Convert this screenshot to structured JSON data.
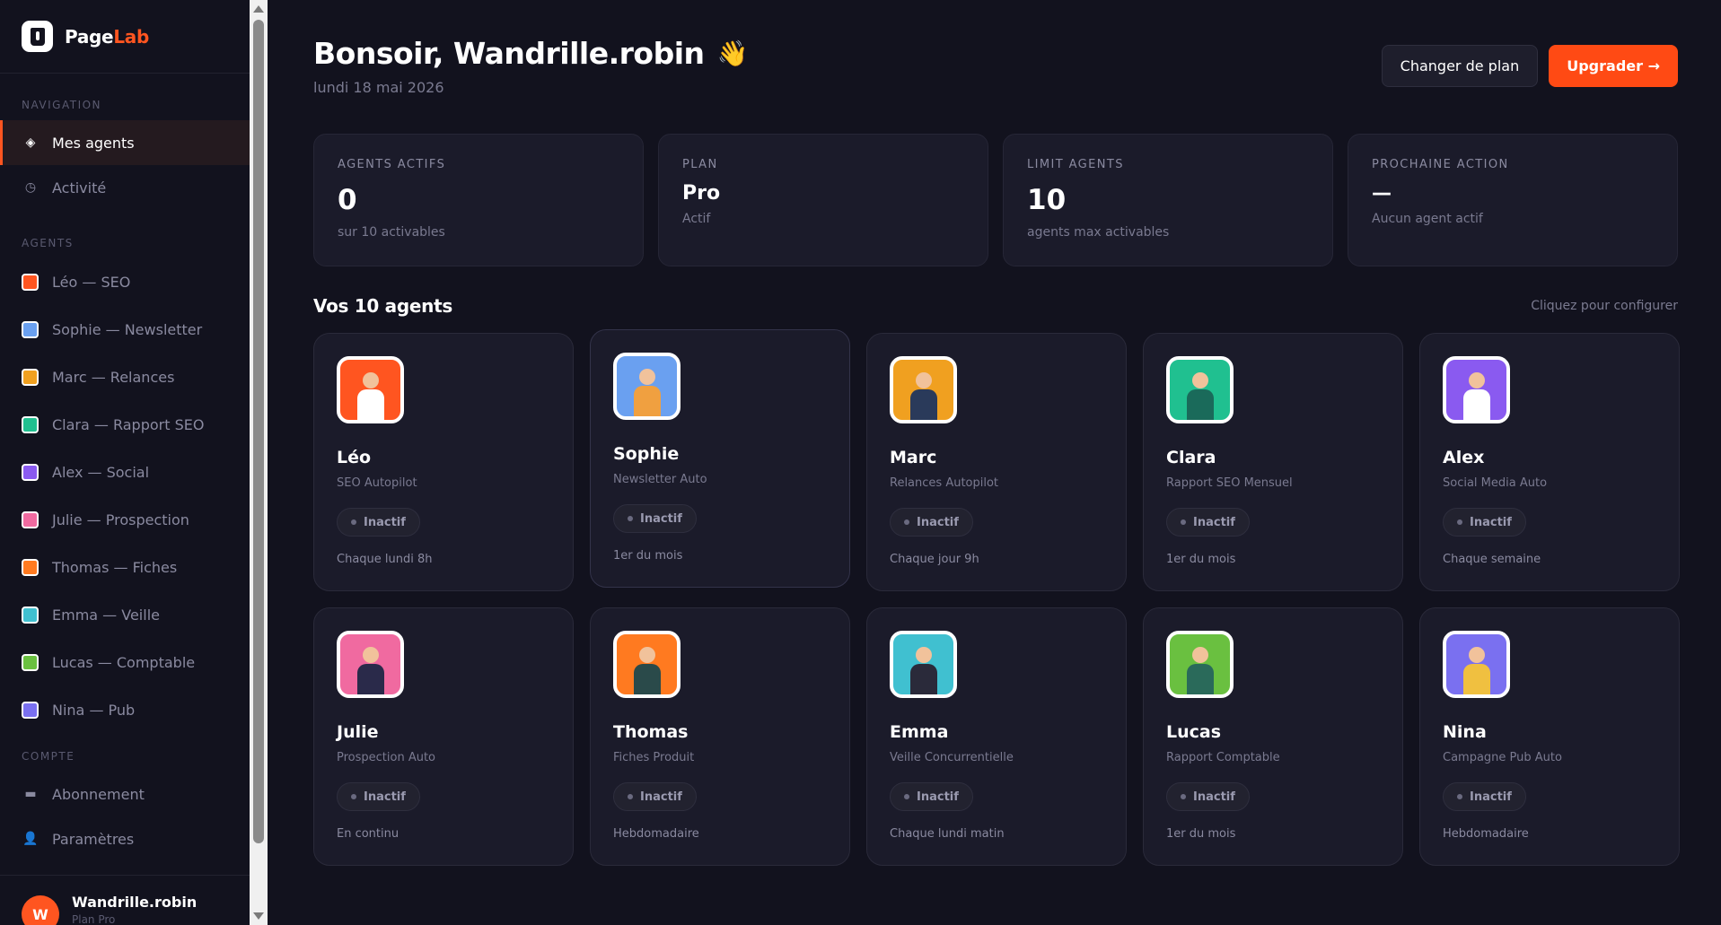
{
  "brand": {
    "name_part1": "Page",
    "name_part2": "Lab"
  },
  "sidebar": {
    "nav_title": "NAVIGATION",
    "nav_items": [
      {
        "label": "Mes agents",
        "icon": "diamond-icon",
        "active": true
      },
      {
        "label": "Activité",
        "icon": "clock-icon",
        "active": false
      }
    ],
    "agents_title": "AGENTS",
    "agents": [
      {
        "label": "Léo — SEO",
        "color": "#ff5520"
      },
      {
        "label": "Sophie — Newsletter",
        "color": "#6aa0f0"
      },
      {
        "label": "Marc — Relances",
        "color": "#f0a020"
      },
      {
        "label": "Clara — Rapport SEO",
        "color": "#20c090"
      },
      {
        "label": "Alex — Social",
        "color": "#8a5af0"
      },
      {
        "label": "Julie — Prospection",
        "color": "#f06aa0"
      },
      {
        "label": "Thomas — Fiches",
        "color": "#ff7a20"
      },
      {
        "label": "Emma — Veille",
        "color": "#40c0d0"
      },
      {
        "label": "Lucas — Comptable",
        "color": "#6ac040"
      },
      {
        "label": "Nina — Pub",
        "color": "#7a70f0"
      }
    ],
    "account_title": "COMPTE",
    "account_items": [
      {
        "label": "Abonnement",
        "icon": "credit-card-icon"
      },
      {
        "label": "Paramètres",
        "icon": "user-icon"
      }
    ],
    "user": {
      "initial": "W",
      "name": "Wandrille.robin",
      "sub": "Plan Pro"
    }
  },
  "header": {
    "greeting": "Bonsoir, Wandrille.robin",
    "wave": "👋",
    "date": "lundi 18 mai 2026",
    "btn_change_plan": "Changer de plan",
    "btn_upgrade": "Upgrader →"
  },
  "stats": [
    {
      "label": "AGENTS ACTIFS",
      "value": "0",
      "sub": "sur 10 activables"
    },
    {
      "label": "PLAN",
      "value": "Pro",
      "sub": "Actif"
    },
    {
      "label": "LIMIT AGENTS",
      "value": "10",
      "sub": "agents max activables"
    },
    {
      "label": "PROCHAINE ACTION",
      "value": "—",
      "sub": "Aucun agent actif"
    }
  ],
  "agents_section": {
    "title": "Vos 10 agents",
    "hint": "Cliquez pour configurer"
  },
  "agents": [
    {
      "name": "Léo",
      "desc": "SEO Autopilot",
      "status": "Inactif",
      "schedule": "Chaque lundi 8h",
      "bg": "#ff5520",
      "body": "#ffffff"
    },
    {
      "name": "Sophie",
      "desc": "Newsletter Auto",
      "status": "Inactif",
      "schedule": "1er du mois",
      "bg": "#6aa0f0",
      "body": "#f0a040"
    },
    {
      "name": "Marc",
      "desc": "Relances Autopilot",
      "status": "Inactif",
      "schedule": "Chaque jour 9h",
      "bg": "#f0a020",
      "body": "#2a3a5a"
    },
    {
      "name": "Clara",
      "desc": "Rapport SEO Mensuel",
      "status": "Inactif",
      "schedule": "1er du mois",
      "bg": "#20c090",
      "body": "#1a6a5a"
    },
    {
      "name": "Alex",
      "desc": "Social Media Auto",
      "status": "Inactif",
      "schedule": "Chaque semaine",
      "bg": "#8a5af0",
      "body": "#ffffff"
    },
    {
      "name": "Julie",
      "desc": "Prospection Auto",
      "status": "Inactif",
      "schedule": "En continu",
      "bg": "#f06aa0",
      "body": "#2a2a4a"
    },
    {
      "name": "Thomas",
      "desc": "Fiches Produit",
      "status": "Inactif",
      "schedule": "Hebdomadaire",
      "bg": "#ff7a20",
      "body": "#2a4a4a"
    },
    {
      "name": "Emma",
      "desc": "Veille Concurrentielle",
      "status": "Inactif",
      "schedule": "Chaque lundi matin",
      "bg": "#40c0d0",
      "body": "#2a2a3a"
    },
    {
      "name": "Lucas",
      "desc": "Rapport Comptable",
      "status": "Inactif",
      "schedule": "1er du mois",
      "bg": "#6ac040",
      "body": "#2a6a5a"
    },
    {
      "name": "Nina",
      "desc": "Campagne Pub Auto",
      "status": "Inactif",
      "schedule": "Hebdomadaire",
      "bg": "#7a70f0",
      "body": "#f0c040"
    }
  ]
}
